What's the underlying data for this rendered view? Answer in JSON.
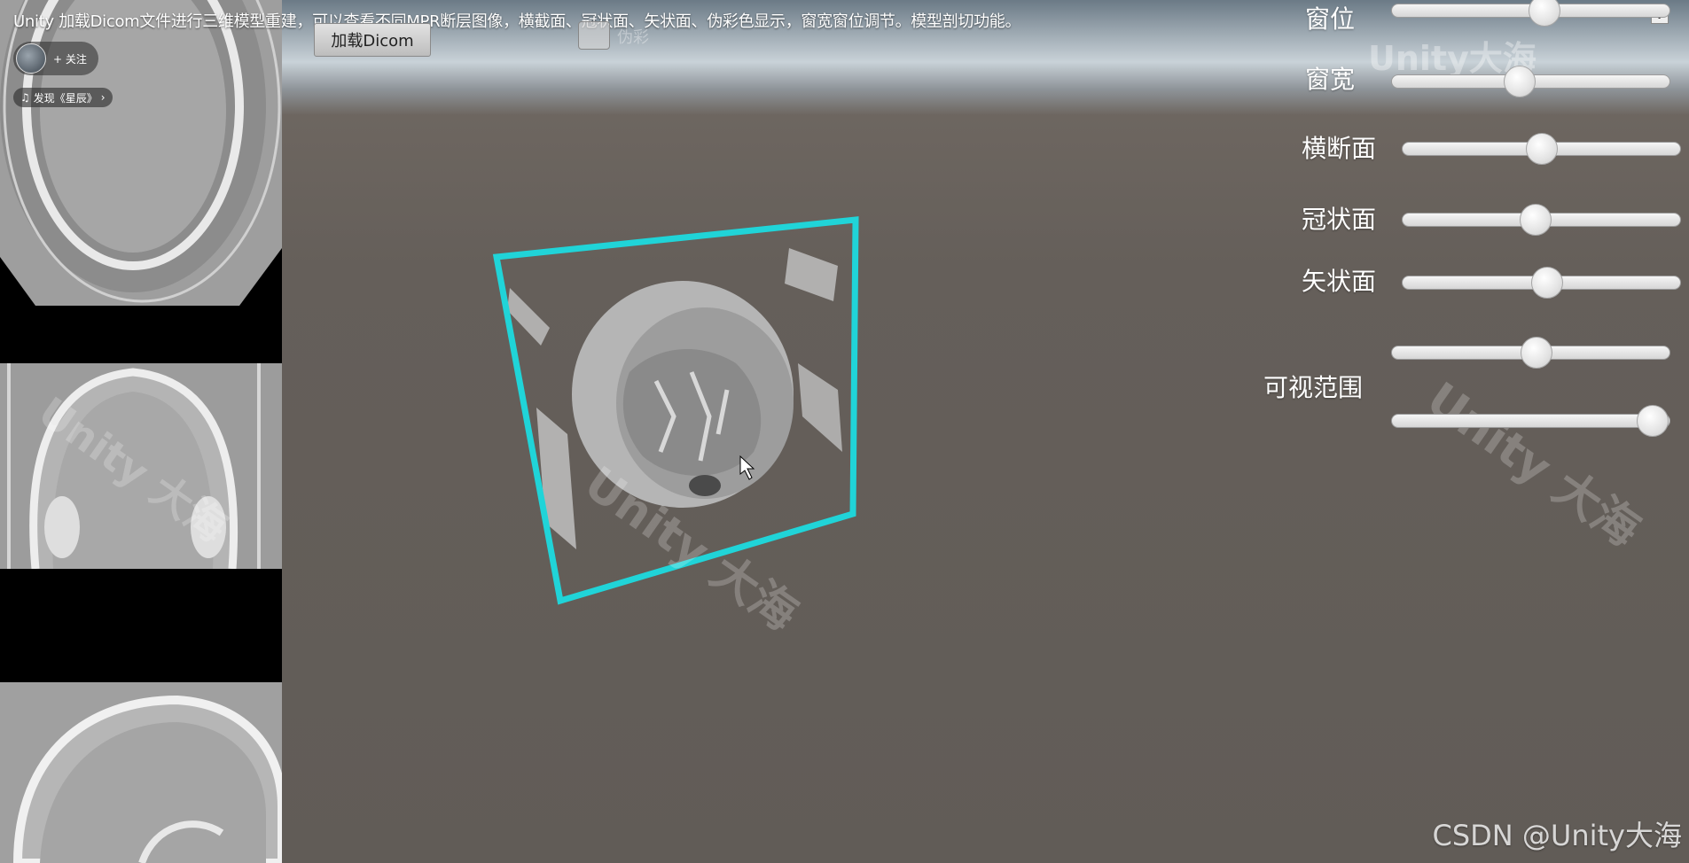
{
  "header": {
    "video_title": "Unity 加载Dicom文件进行三维模型重建，可以查看不同MPR断层图像，横截面、冠状面、矢状面、伪彩色显示，窗宽窗位调节。模型剖切功能。",
    "follow_label": "+ 关注",
    "music_label": "发现《星辰》",
    "music_icon": "music-note-icon",
    "music_chevron": "chevron-right-icon"
  },
  "toolbar": {
    "load_dicom_label": "加载Dicom",
    "checkbox_label": "伪彩",
    "checkbox_checked": false,
    "help_label": "?"
  },
  "controls": {
    "window_level": {
      "label": "窗位",
      "value": 0.55
    },
    "window_width": {
      "label": "窗宽",
      "value": 0.46
    },
    "axial": {
      "label": "横断面",
      "value": 0.5
    },
    "coronal": {
      "label": "冠状面",
      "value": 0.48
    },
    "sagittal": {
      "label": "矢状面",
      "value": 0.52
    },
    "visible_range": {
      "label": "可视范围",
      "min_value": 0.52,
      "max_value": 0.94
    }
  },
  "mpr_views": {
    "axial": "axial-slice",
    "coronal": "coronal-slice",
    "sagittal": "sagittal-slice"
  },
  "watermarks": {
    "top": "Unity大海",
    "overlay": "Unity 大海",
    "credit": "CSDN @Unity大海"
  },
  "colors": {
    "bounding_box": "#20d4d8",
    "scene_ground": "#645e59",
    "model": "#b8b8b8"
  }
}
